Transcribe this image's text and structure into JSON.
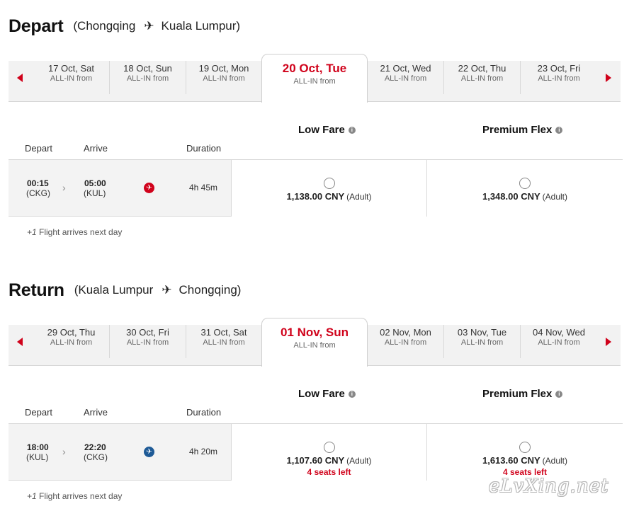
{
  "depart": {
    "title": "Depart",
    "origin": "(Chongqing",
    "destination": "Kuala Lumpur)",
    "dates": [
      {
        "label": "17 Oct, Sat",
        "sub": "ALL-IN from"
      },
      {
        "label": "18 Oct, Sun",
        "sub": "ALL-IN from"
      },
      {
        "label": "19 Oct, Mon",
        "sub": "ALL-IN from"
      },
      {
        "label": "20 Oct, Tue",
        "sub": "ALL-IN from"
      },
      {
        "label": "21 Oct, Wed",
        "sub": "ALL-IN from"
      },
      {
        "label": "22 Oct, Thu",
        "sub": "ALL-IN from"
      },
      {
        "label": "23 Oct, Fri",
        "sub": "ALL-IN from"
      }
    ],
    "fare_low": "Low Fare",
    "fare_flex": "Premium Flex",
    "col_depart": "Depart",
    "col_arrive": "Arrive",
    "col_duration": "Duration",
    "flight": {
      "dep_time": "00:15",
      "dep_code": "(CKG)",
      "arr_time": "05:00",
      "arr_code": "(KUL)",
      "duration": "4h 45m",
      "low_price": "1,138.00 CNY",
      "flex_price": "1,348.00 CNY",
      "adult": "(Adult)"
    },
    "footnote_mark": "+1",
    "footnote_text": " Flight arrives next day"
  },
  "return": {
    "title": "Return",
    "origin": "(Kuala Lumpur",
    "destination": "Chongqing)",
    "dates": [
      {
        "label": "29 Oct, Thu",
        "sub": "ALL-IN from"
      },
      {
        "label": "30 Oct, Fri",
        "sub": "ALL-IN from"
      },
      {
        "label": "31 Oct, Sat",
        "sub": "ALL-IN from"
      },
      {
        "label": "01 Nov, Sun",
        "sub": "ALL-IN from"
      },
      {
        "label": "02 Nov, Mon",
        "sub": "ALL-IN from"
      },
      {
        "label": "03 Nov, Tue",
        "sub": "ALL-IN from"
      },
      {
        "label": "04 Nov, Wed",
        "sub": "ALL-IN from"
      }
    ],
    "fare_low": "Low Fare",
    "fare_flex": "Premium Flex",
    "col_depart": "Depart",
    "col_arrive": "Arrive",
    "col_duration": "Duration",
    "flight": {
      "dep_time": "18:00",
      "dep_code": "(KUL)",
      "arr_time": "22:20",
      "arr_code": "(CKG)",
      "duration": "4h 20m",
      "low_price": "1,107.60 CNY",
      "flex_price": "1,613.60 CNY",
      "adult": "(Adult)",
      "seats_low": "4 seats left",
      "seats_flex": "4 seats left"
    },
    "footnote_mark": "+1",
    "footnote_text": " Flight arrives next day"
  },
  "colors": {
    "accent": "#d0021b",
    "strip": "#f2f2f2",
    "airline_blue": "#1e5a96"
  },
  "icons": {
    "route": "airplane-icon",
    "info": "info-icon",
    "prev": "arrow-left-icon",
    "next": "arrow-right-icon"
  },
  "watermark": "eLvXing.net"
}
